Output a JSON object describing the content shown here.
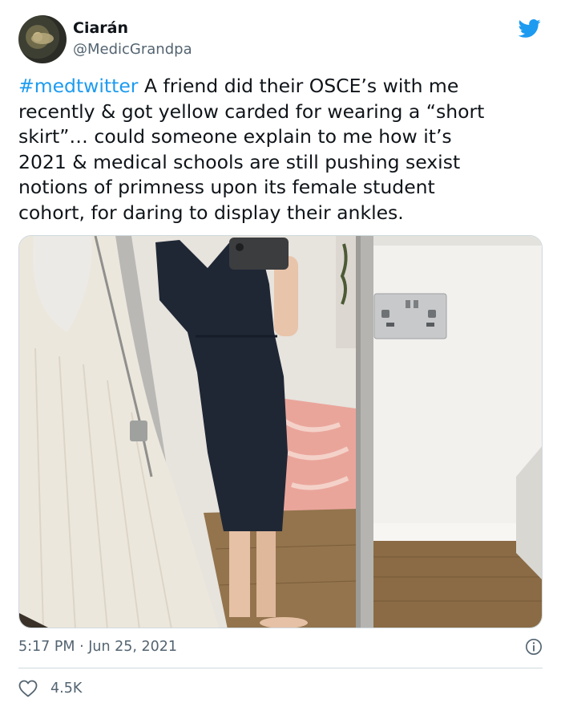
{
  "author": {
    "name": "Ciarán",
    "handle": "@MedicGrandpa"
  },
  "tweet": {
    "hashtag": "#medtwitter",
    "body": " A friend did their OSCE’s with me\nrecently & got yellow carded for wearing a “short\nskirt”… could someone explain to me how it’s\n2021 & medical schools are still pushing sexist\nnotions of primness upon its female student\ncohort, for daring to display their ankles.",
    "time": "5:17 PM",
    "separator": " · ",
    "date": "Jun 25, 2021",
    "likes": "4.5K"
  },
  "icons": {
    "brand": "twitter-bird-icon",
    "info": "info-icon",
    "like": "heart-icon"
  },
  "colors": {
    "accent": "#1d9bf0",
    "text": "#0f1419",
    "secondary": "#536471",
    "border": "#cfd9de"
  }
}
